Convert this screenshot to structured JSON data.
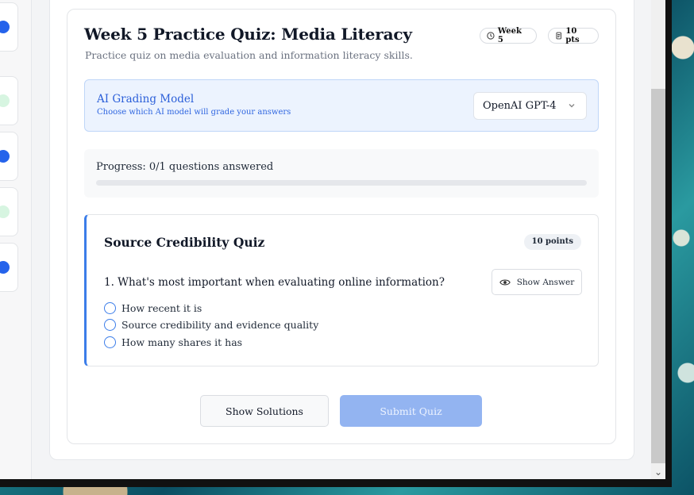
{
  "quiz": {
    "title": "Week 5 Practice Quiz: Media Literacy",
    "description": "Practice quiz on media evaluation and information literacy skills.",
    "week_badge": "Week 5",
    "points_badge": "10 pts"
  },
  "grading": {
    "title": "AI Grading Model",
    "subtitle": "Choose which AI model will grade your answers",
    "selected_model": "OpenAI GPT-4"
  },
  "progress": {
    "label": "Progress: 0/1 questions answered",
    "fraction": 0
  },
  "question_card": {
    "title": "Source Credibility Quiz",
    "points": "10 points",
    "question": "1. What's most important when evaluating online information?",
    "show_answer_label": "Show Answer",
    "options": [
      "How recent it is",
      "Source credibility and evidence quality",
      "How many shares it has"
    ]
  },
  "actions": {
    "show_solutions": "Show Solutions",
    "submit_quiz": "Submit Quiz"
  },
  "colors": {
    "accent": "#3b7de9",
    "submit_disabled": "#93b4f1",
    "ai_box_bg": "#ecf3fe"
  }
}
